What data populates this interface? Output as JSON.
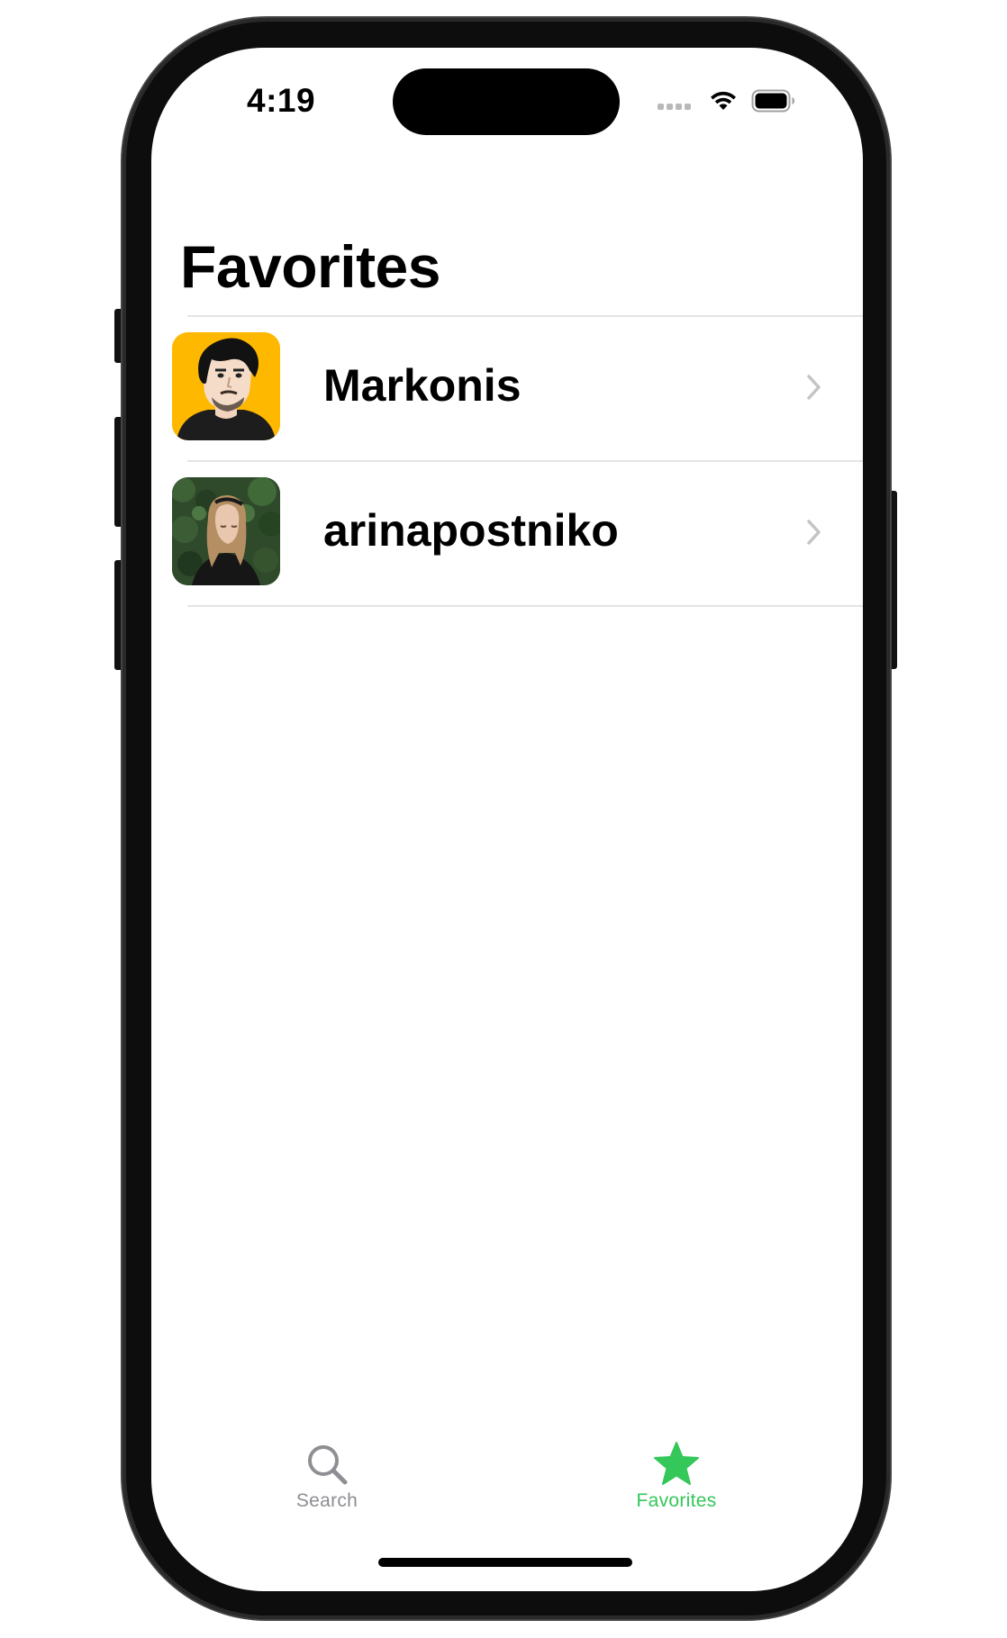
{
  "status_bar": {
    "time": "4:19"
  },
  "header": {
    "title": "Favorites"
  },
  "favorites": [
    {
      "name": "Markonis",
      "avatar": "cartoon-portrait-avatar",
      "avatar_bg": "#ffb800"
    },
    {
      "name": "arinapostniko",
      "avatar": "photo-portrait-avatar",
      "avatar_bg": "#2f4a2a"
    }
  ],
  "tab_bar": {
    "tabs": [
      {
        "label": "Search",
        "icon": "search-icon",
        "selected": false
      },
      {
        "label": "Favorites",
        "icon": "star-icon",
        "selected": true
      }
    ]
  },
  "colors": {
    "accent": "#34c759",
    "inactive_tab": "#8e8e93",
    "separator": "#e4e4e6"
  }
}
